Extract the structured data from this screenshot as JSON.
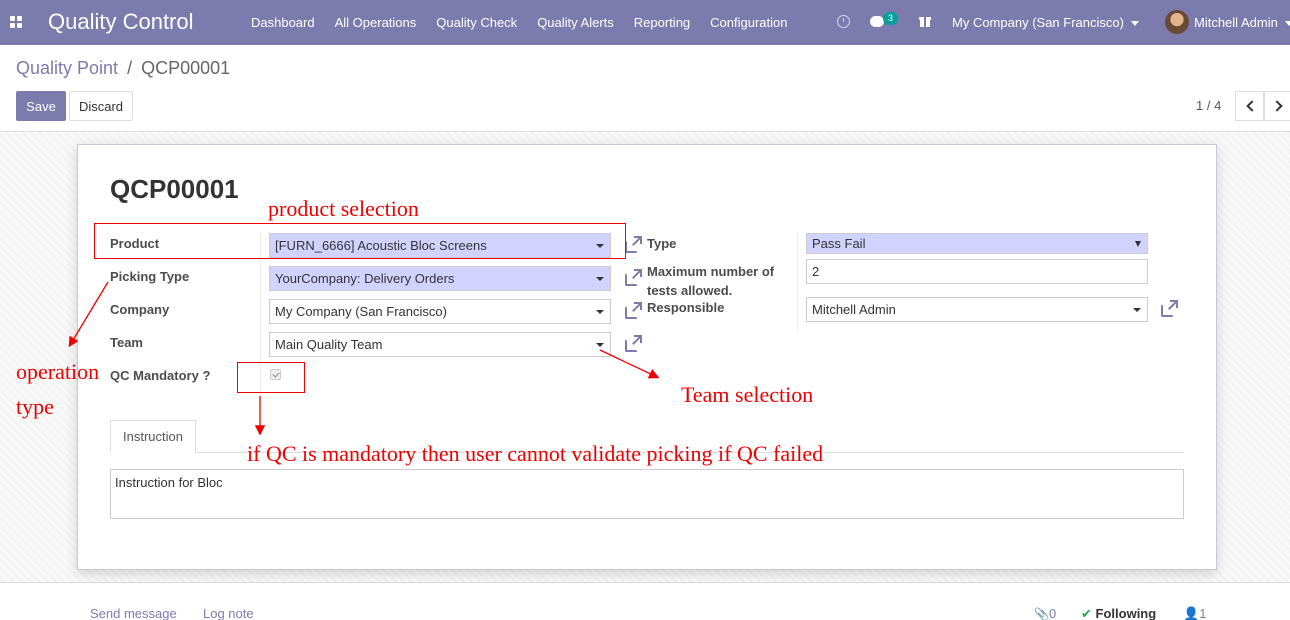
{
  "navbar": {
    "brand": "Quality Control",
    "menu": [
      "Dashboard",
      "All Operations",
      "Quality Check",
      "Quality Alerts",
      "Reporting",
      "Configuration"
    ],
    "messages_badge": "3",
    "company": "My Company (San Francisco)",
    "user": "Mitchell Admin"
  },
  "breadcrumb": {
    "parent": "Quality Point",
    "separator": "/",
    "current": "QCP00001"
  },
  "buttons": {
    "save": "Save",
    "discard": "Discard"
  },
  "pager": {
    "value": "1 / 4"
  },
  "form": {
    "title": "QCP00001",
    "product_label": "Product",
    "product_value": "[FURN_6666] Acoustic Bloc Screens",
    "picking_type_label": "Picking Type",
    "picking_type_value": "YourCompany: Delivery Orders",
    "company_label": "Company",
    "company_value": "My Company (San Francisco)",
    "team_label": "Team",
    "team_value": "Main Quality Team",
    "qc_mandatory_label": "QC Mandatory ?",
    "qc_mandatory_checked": true,
    "type_label": "Type",
    "type_value": "Pass Fail",
    "max_tests_label_line1": "Maximum number of",
    "max_tests_label_line2": "tests allowed.",
    "max_tests_value": "2",
    "responsible_label": "Responsible",
    "responsible_value": "Mitchell Admin"
  },
  "tabs": {
    "instruction": "Instruction"
  },
  "instruction_text": "Instruction for Bloc",
  "annotations": {
    "product_selection": "product selection",
    "operation_line1": "operation",
    "operation_line2": "type",
    "team_selection": "Team selection",
    "qc_note": "if QC is mandatory then user cannot validate picking if QC failed",
    "color": "#e00000"
  },
  "chatter": {
    "send_message": "Send message",
    "log_note": "Log note",
    "attachments": "0",
    "following": "Following",
    "followers": "1"
  },
  "colors": {
    "primary": "#7c7bad",
    "field_fill": "#d2d2ff",
    "badge": "#00a09d"
  }
}
